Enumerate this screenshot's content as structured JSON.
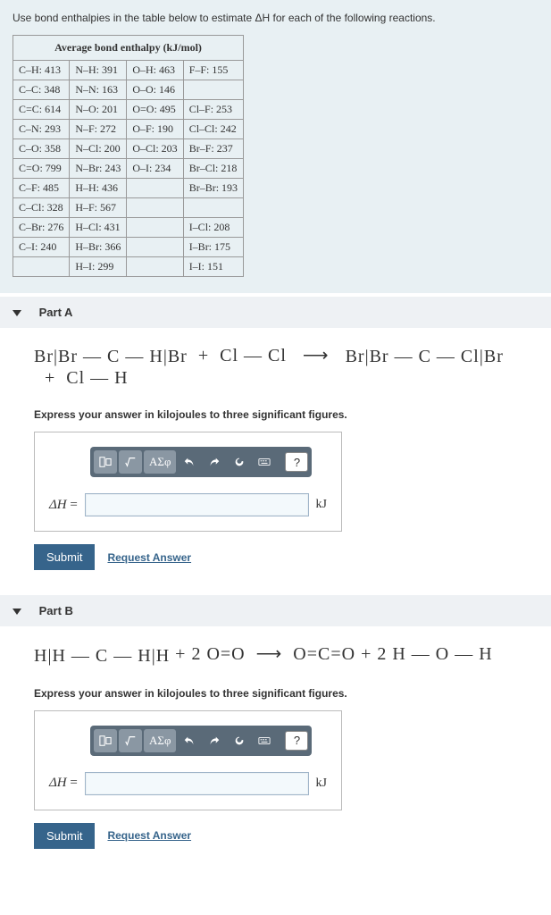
{
  "intro": "Use bond enthalpies in the table below to estimate ΔH for each of the following reactions.",
  "table": {
    "header": "Average bond enthalpy (kJ/mol)",
    "rows": [
      [
        "C–H:  413",
        "N–H:  391",
        "O–H:  463",
        "F–F:   155"
      ],
      [
        "C–C:  348",
        "N–N:  163",
        "O–O:  146",
        ""
      ],
      [
        "C=C:  614",
        "N–O:  201",
        "O=O:   495",
        "Cl–F:  253"
      ],
      [
        "C–N:  293",
        "N–F:  272",
        "O–F:  190",
        "Cl–Cl: 242"
      ],
      [
        "C–O:  358",
        "N–Cl: 200",
        "O–Cl: 203",
        "Br–F:  237"
      ],
      [
        "C=O:  799",
        "N–Br: 243",
        "O–I:   234",
        "Br–Cl: 218"
      ],
      [
        "C–F:  485",
        "H–H:  436",
        "",
        "Br–Br: 193"
      ],
      [
        "C–Cl: 328",
        "H–F:   567",
        "",
        ""
      ],
      [
        "C–Br: 276",
        "H–Cl: 431",
        "",
        "I–Cl:  208"
      ],
      [
        "C–I:   240",
        "H–Br: 366",
        "",
        "I–Br:  175"
      ],
      [
        "",
        "H–I:   299",
        "",
        "I–I:   151"
      ]
    ]
  },
  "parts": {
    "a": {
      "title": "Part A",
      "reaction_html": "<span class='col'><span>Br</span><span>|</span><span class='row3'>Br — C — H</span><span>|</span><span>Br</span></span>&nbsp;&nbsp;+&nbsp;&nbsp;Cl — Cl&nbsp;&nbsp;&nbsp;⟶&nbsp;&nbsp;&nbsp;<span class='col'><span>Br</span><span>|</span><span class='row3'>Br — C — Cl</span><span>|</span><span>Br</span></span>&nbsp;&nbsp;+&nbsp;&nbsp;Cl — H",
      "instruction": "Express your answer in kilojoules to three significant figures.",
      "label": "ΔH =",
      "unit": "kJ",
      "submit": "Submit",
      "request": "Request Answer",
      "help": "?",
      "symbols": "ΑΣφ"
    },
    "b": {
      "title": "Part B",
      "reaction_html": "<span class='col'><span>H</span><span>|</span><span class='row3'>H — C — H</span><span>|</span><span>H</span></span>&nbsp;+&nbsp;2&nbsp;O=O&nbsp;&nbsp;⟶&nbsp;&nbsp;O=C=O&nbsp;+&nbsp;2&nbsp;H — O — H",
      "instruction": "Express your answer in kilojoules to three significant figures.",
      "label": "ΔH =",
      "unit": "kJ",
      "submit": "Submit",
      "request": "Request Answer",
      "help": "?",
      "symbols": "ΑΣφ"
    }
  }
}
